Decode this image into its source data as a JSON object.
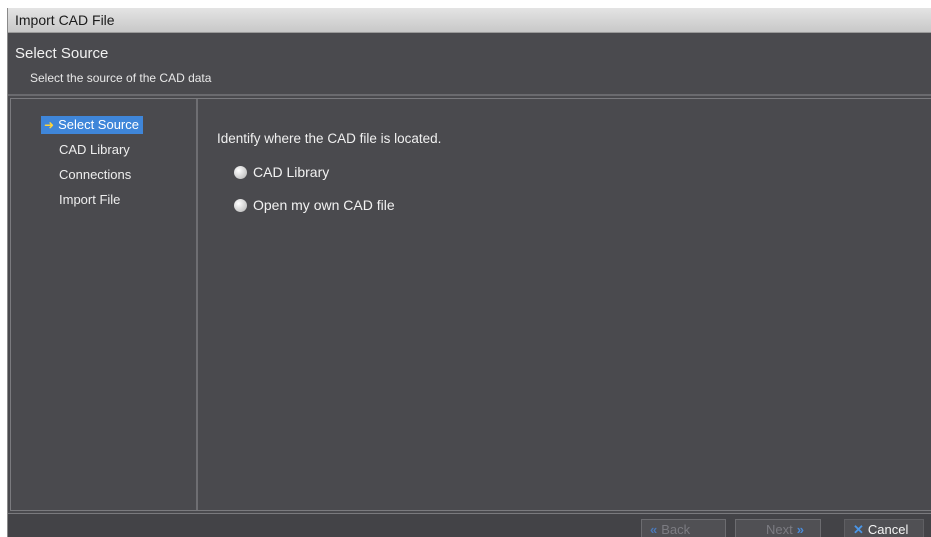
{
  "window": {
    "title": "Import CAD File"
  },
  "header": {
    "title": "Select Source",
    "subtitle": "Select the source of the CAD data"
  },
  "nav": {
    "items": [
      {
        "label": "Select Source",
        "active": true
      },
      {
        "label": "CAD Library",
        "active": false
      },
      {
        "label": "Connections",
        "active": false
      },
      {
        "label": "Import File",
        "active": false
      }
    ]
  },
  "content": {
    "prompt": "Identify where the CAD file is located.",
    "options": [
      {
        "label": "CAD Library",
        "selected": false
      },
      {
        "label": "Open my own CAD file",
        "selected": false
      }
    ]
  },
  "footer": {
    "back_label": "Back",
    "next_label": "Next",
    "cancel_label": "Cancel"
  },
  "icons": {
    "active_nav": "arrow-right-icon",
    "back": "chevron-left-icon",
    "next": "chevron-right-icon",
    "cancel": "x-icon"
  },
  "colors": {
    "accent": "#3f86d9",
    "background": "#4a4a4e",
    "arrow": "#ffd43a"
  }
}
